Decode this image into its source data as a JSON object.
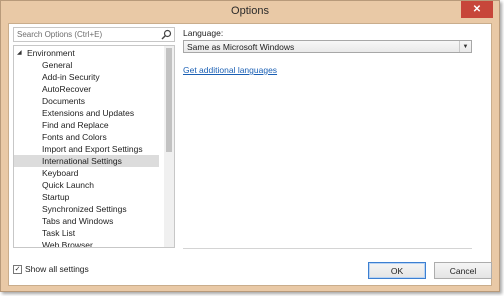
{
  "window": {
    "title": "Options",
    "close_label": "✕"
  },
  "search": {
    "placeholder": "Search Options (Ctrl+E)"
  },
  "tree": {
    "root": {
      "label": "Environment",
      "expander": "◢"
    },
    "items": [
      {
        "label": "General"
      },
      {
        "label": "Add-in Security"
      },
      {
        "label": "AutoRecover"
      },
      {
        "label": "Documents"
      },
      {
        "label": "Extensions and Updates"
      },
      {
        "label": "Find and Replace"
      },
      {
        "label": "Fonts and Colors"
      },
      {
        "label": "Import and Export Settings"
      },
      {
        "label": "International Settings",
        "selected": true
      },
      {
        "label": "Keyboard"
      },
      {
        "label": "Quick Launch"
      },
      {
        "label": "Startup"
      },
      {
        "label": "Synchronized Settings"
      },
      {
        "label": "Tabs and Windows"
      },
      {
        "label": "Task List"
      },
      {
        "label": "Web Browser"
      }
    ],
    "selected_index": 8
  },
  "settings": {
    "language_label": "Language:",
    "language_value": "Same as Microsoft Windows",
    "additional_languages_link": "Get additional languages"
  },
  "footer": {
    "show_all_label": "Show all settings",
    "show_all_checked": true,
    "ok_label": "OK",
    "cancel_label": "Cancel"
  }
}
